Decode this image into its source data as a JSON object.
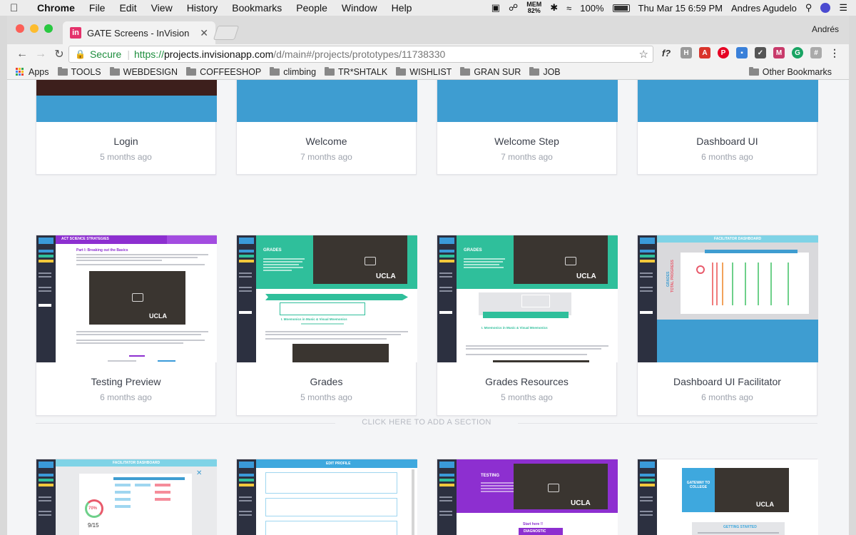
{
  "menubar": {
    "app_name": "Chrome",
    "items": [
      "File",
      "Edit",
      "View",
      "History",
      "Bookmarks",
      "People",
      "Window",
      "Help"
    ],
    "mem_label": "MEM",
    "mem_value": "82%",
    "battery": "100%",
    "clock": "Thu Mar 15  6:59 PM",
    "user": "Andres Agudelo"
  },
  "browser": {
    "tab_title": "GATE Screens - InVision",
    "tab_favicon": "in",
    "profile_name": "Andrés",
    "secure_label": "Secure",
    "url_scheme": "https://",
    "url_host": "projects.invisionapp.com",
    "url_path": "/d/main#/projects/prototypes/11738330"
  },
  "bookmarks": {
    "apps_label": "Apps",
    "items": [
      "TOOLS",
      "WEBDESIGN",
      "COFFEESHOP",
      "climbing",
      "TR*SHTALK",
      "WISHLIST",
      "GRAN SUR",
      "JOB"
    ],
    "other_label": "Other Bookmarks"
  },
  "screens": {
    "row1": [
      {
        "title": "Login",
        "time": "5 months ago"
      },
      {
        "title": "Welcome",
        "time": "7 months ago"
      },
      {
        "title": "Welcome Step",
        "time": "7 months ago"
      },
      {
        "title": "Dashboard UI",
        "time": "6 months ago"
      }
    ],
    "row2": [
      {
        "title": "Testing Preview",
        "time": "6 months ago"
      },
      {
        "title": "Grades",
        "time": "5 months ago"
      },
      {
        "title": "Grades Resources",
        "time": "5 months ago"
      },
      {
        "title": "Dashboard UI Facilitator",
        "time": "6 months ago"
      }
    ]
  },
  "thumb_text": {
    "ucla": "UCLA",
    "act_header": "ACT SCIENCE STRATEGIES",
    "part_title": "Part I: Breaking out the Basics",
    "grades_header": "GRADES",
    "mnemonics": "I. Mnemonics in Music & Visual Mnemonics",
    "facilitator": "FACILITATOR DASHBOARD",
    "grades_vertical": "GRADES",
    "total_progress": "TOTAL PROGRESS",
    "progress_pct": "70%",
    "score": "9/15",
    "edit_profile": "EDIT PROFILE",
    "testing_header": "TESTING",
    "start_here": "Start here !!",
    "diagnostic": "DIAGNOSTIC",
    "gateway": "GATEWAY TO COLLEGE",
    "getting_started": "GETTING STARTED"
  },
  "add_section_label": "CLICK HERE TO ADD A SECTION",
  "colors": {
    "accent_blue": "#3e9dd1",
    "teal": "#2fbf9b",
    "purple": "#8d2fd0",
    "sidebar": "#2c3040"
  }
}
